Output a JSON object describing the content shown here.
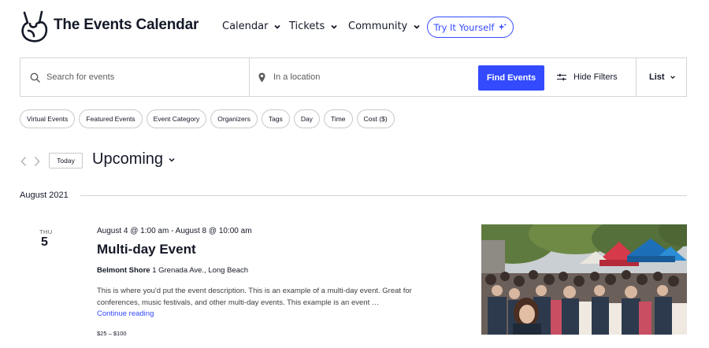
{
  "header": {
    "brand": "The Events Calendar",
    "nav": [
      {
        "label": "Calendar"
      },
      {
        "label": "Tickets"
      },
      {
        "label": "Community"
      }
    ],
    "cta_label": "Try It Yourself",
    "cta_icon": "sparkle-icon"
  },
  "colors": {
    "accent": "#334aff",
    "text": "#141827",
    "border": "#d5d5d5"
  },
  "search": {
    "keyword_placeholder": "Search for events",
    "location_placeholder": "In a location",
    "find_label": "Find Events",
    "filters_label": "Hide Filters",
    "view_label": "List"
  },
  "filters": [
    "Virtual Events",
    "Featured Events",
    "Event Category",
    "Organizers",
    "Tags",
    "Day",
    "Time",
    "Cost ($)"
  ],
  "navigation": {
    "today_label": "Today",
    "range_label": "Upcoming"
  },
  "month_separator": "August 2021",
  "event": {
    "day_of_week": "THU",
    "day_number": "5",
    "datetime": "August 4 @ 1:00 am - August 8 @ 10:00 am",
    "title": "Multi-day Event",
    "venue_name": "Belmont Shore",
    "venue_address": "1 Grenada Ave., Long Beach",
    "description": "This is where you'd put the event description. This is an example of a multi-day event. Great for conferences, music festivals, and other multi-day events. This example is an event …",
    "more_label": "Continue reading",
    "cost": "$25 – $100"
  }
}
